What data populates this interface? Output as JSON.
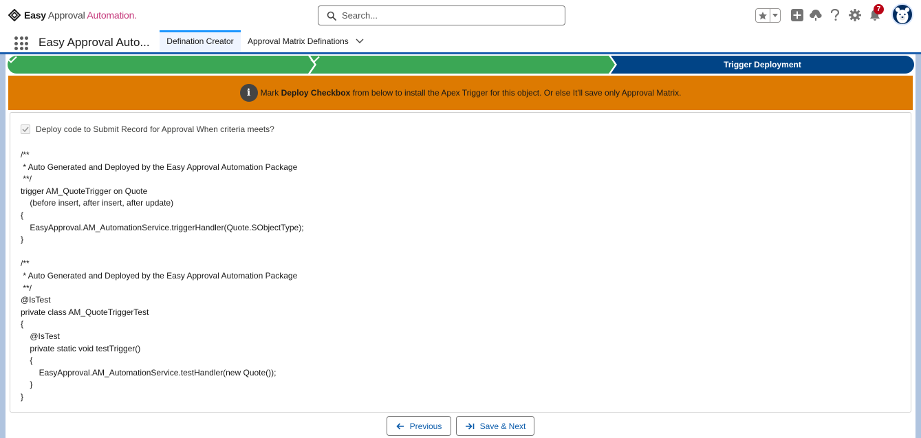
{
  "brand": {
    "name_bold": "Easy",
    "name_mid": "Approval",
    "name_accent": "Automation."
  },
  "search": {
    "placeholder": "Search..."
  },
  "header": {
    "notification_count": "7",
    "icons": [
      "favorites-star-icon",
      "add-icon",
      "trailhead-icon",
      "help-icon",
      "setup-gear-icon",
      "notification-bell-icon",
      "avatar"
    ]
  },
  "app_nav": {
    "app_name": "Easy Approval Auto...",
    "tabs": [
      {
        "label": "Defination Creator",
        "active": true
      },
      {
        "label": "Approval Matrix Definations",
        "active": false
      }
    ]
  },
  "path": {
    "steps": [
      {
        "label": "",
        "status": "complete"
      },
      {
        "label": "",
        "status": "complete"
      },
      {
        "label": "Trigger Deployment",
        "status": "current"
      }
    ],
    "colors": {
      "complete": "#3ba755",
      "current": "#014486"
    }
  },
  "banner": {
    "prefix": "Mark ",
    "bold": "Deploy Checkbox",
    "suffix": " from below to install the Apex Trigger for this object. Or else It'll save only Approval Matrix.",
    "color": "#dd7a01"
  },
  "deploy_option": {
    "label": "Deploy code to Submit Record for Approval When criteria meets?",
    "checked": true
  },
  "code_lines": [
    "/**",
    " * Auto Generated and Deployed by the Easy Approval Automation Package",
    " **/",
    "trigger AM_QuoteTrigger on Quote",
    "    (before insert, after insert, after update)",
    "{",
    "    EasyApproval.AM_AutomationService.triggerHandler(Quote.SObjectType);",
    "}",
    "",
    "/**",
    " * Auto Generated and Deployed by the Easy Approval Automation Package",
    " **/",
    "@IsTest",
    "private class AM_QuoteTriggerTest",
    "{",
    "    @IsTest",
    "    private static void testTrigger()",
    "    {",
    "        EasyApproval.AM_AutomationService.testHandler(new Quote());",
    "    }",
    "}"
  ],
  "buttons": {
    "previous": "Previous",
    "save_next": "Save & Next"
  }
}
